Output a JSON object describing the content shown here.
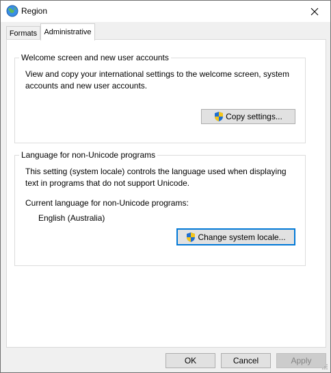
{
  "window": {
    "title": "Region",
    "icon": "globe-icon"
  },
  "tabs": [
    {
      "label": "Formats",
      "active": false
    },
    {
      "label": "Administrative",
      "active": true
    }
  ],
  "welcome_group": {
    "title": "Welcome screen and new user accounts",
    "description": "View and copy your international settings to the welcome screen, system accounts and new user accounts.",
    "copy_button": "Copy settings..."
  },
  "locale_group": {
    "title": "Language for non-Unicode programs",
    "description": "This setting (system locale) controls the language used when displaying text in programs that do not support Unicode.",
    "current_label": "Current language for non-Unicode programs:",
    "current_value": "English (Australia)",
    "change_button": "Change system locale..."
  },
  "footer": {
    "ok": "OK",
    "cancel": "Cancel",
    "apply": "Apply"
  },
  "colors": {
    "focus": "#0078d7",
    "shield_blue": "#1f6fd1",
    "shield_yellow": "#f5c518"
  }
}
